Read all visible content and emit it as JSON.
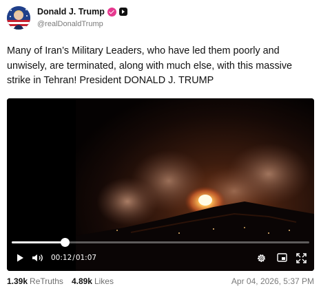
{
  "author": {
    "name": "Donald J. Trump",
    "handle": "@realDonaldTrump",
    "verified_color": "#e6398f"
  },
  "post": {
    "text": "Many of Iran’s Military Leaders, who have led them poorly and unwisely, are terminated, along with much else, with this massive strike in Tehran! President DONALD J. TRUMP"
  },
  "video": {
    "current_time": "00:12",
    "separator": "/",
    "duration": "01:07",
    "progress_fraction": 0.179,
    "icons": [
      "play-icon",
      "volume-icon",
      "gear-icon",
      "picture-in-picture-icon",
      "fullscreen-icon"
    ]
  },
  "stats": {
    "retruths_count": "1.39k",
    "retruths_label": "ReTruths",
    "likes_count": "4.89k",
    "likes_label": "Likes"
  },
  "timestamp": "Apr 04, 2026, 5:37 PM"
}
